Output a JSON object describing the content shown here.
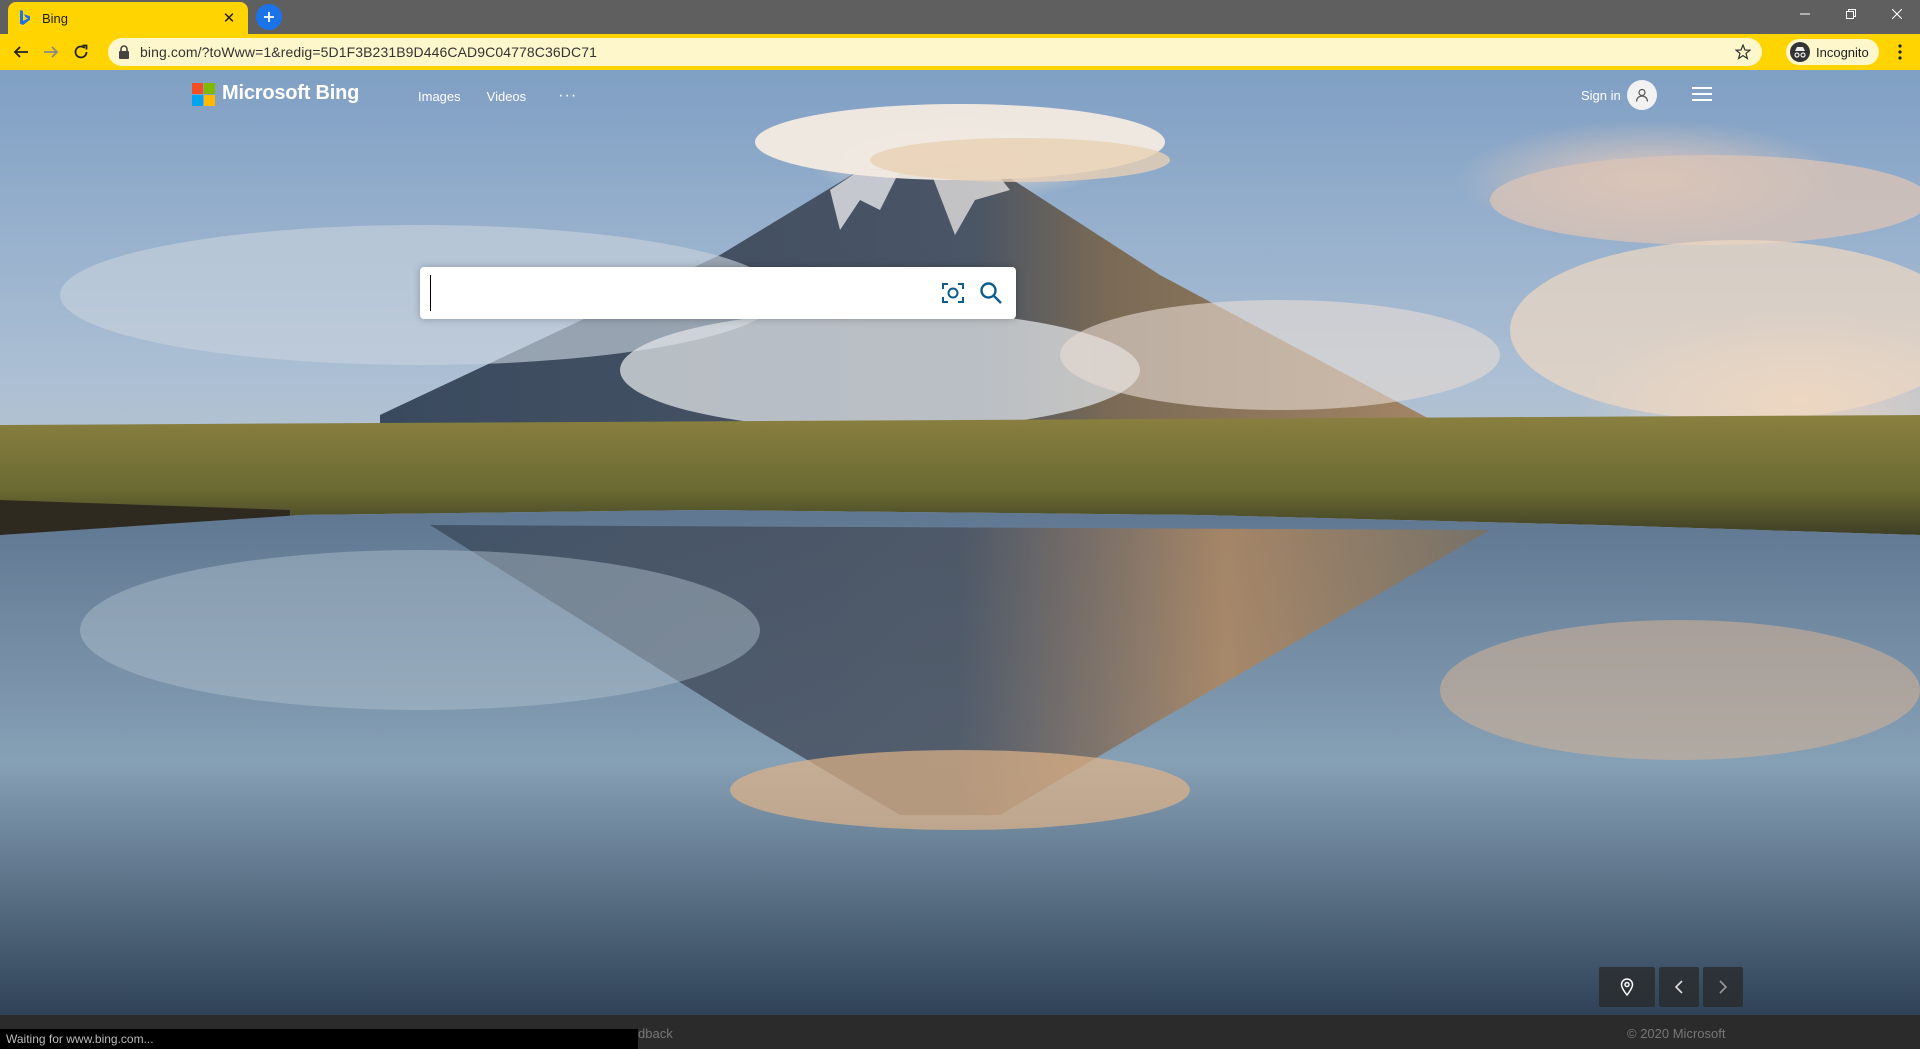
{
  "browser": {
    "tab_title": "Bing",
    "url": "bing.com/?toWww=1&redig=5D1F3B231B9D446CAD9C04778C36DC71",
    "incognito_label": "Incognito",
    "status_text": "Waiting for www.bing.com..."
  },
  "bing": {
    "logo_text": "Microsoft Bing",
    "nav": [
      "Images",
      "Videos"
    ],
    "more_label": "···",
    "signin_label": "Sign in",
    "search_placeholder": "",
    "footer_feedback": "dback",
    "footer_copyright": "© 2020 Microsoft"
  },
  "icons": {
    "favicon": "bing-icon",
    "lock": "lock-icon",
    "star": "star-icon",
    "visual_search": "visual-search-icon",
    "search": "search-icon",
    "location": "location-pin-icon",
    "prev": "chevron-left-icon",
    "next": "chevron-right-icon"
  },
  "colors": {
    "chrome_accent": "#ffd400",
    "logo_red": "#f25022",
    "logo_green": "#7fba00",
    "logo_blue": "#00a4ef",
    "logo_yellow": "#ffb900",
    "search_icon": "#0c5c8e"
  }
}
